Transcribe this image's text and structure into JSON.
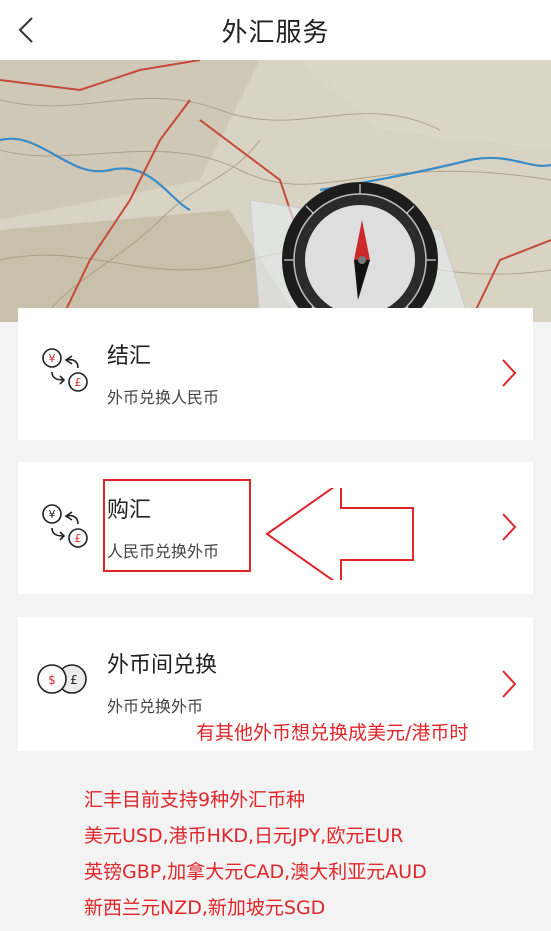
{
  "header": {
    "back_icon": "chevron-left-icon",
    "title": "外汇服务"
  },
  "banner": {
    "image": "map-and-compass-photo"
  },
  "services": [
    {
      "title": "结汇",
      "subtitle": "外币兑换人民币",
      "icon": "currency-exchange-yen-pound-icon"
    },
    {
      "title": "购汇",
      "subtitle": "人民币兑换外币",
      "icon": "currency-exchange-yen-pound-icon"
    },
    {
      "title": "外币间兑换",
      "subtitle": "外币兑换外币",
      "icon": "dollar-pound-coins-icon"
    }
  ],
  "annotations": {
    "inline_note": "有其他外币想兑换成美元/港币时",
    "notes": [
      "汇丰目前支持9种外汇币种",
      "美元USD,港币HKD,日元JPY,欧元EUR",
      "英镑GBP,加拿大元CAD,澳大利亚元AUD",
      "新西兰元NZD,新加坡元SGD"
    ]
  },
  "colors": {
    "annotation_red": "#e0262a",
    "page_bg": "#f3f3f3",
    "card_bg": "#ffffff"
  }
}
